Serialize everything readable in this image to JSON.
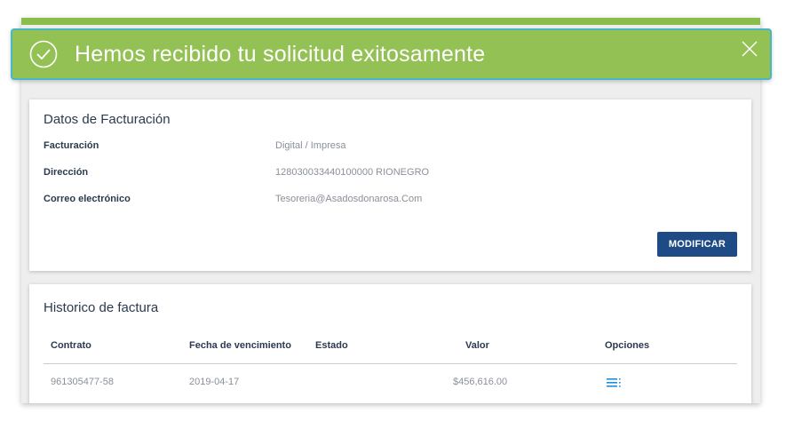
{
  "toast": {
    "message": "Hemos recibido tu solicitud exitosamente",
    "check_icon": "check-circle-icon",
    "close_icon": "close-icon"
  },
  "billing": {
    "title": "Datos de Facturación",
    "rows": [
      {
        "label": "Facturación",
        "value": "Digital / Impresa"
      },
      {
        "label": "Dirección",
        "value": "128030033440100000 RIONEGRO"
      },
      {
        "label": "Correo electrónico",
        "value": "Tesoreria@Asadosdonarosa.Com"
      }
    ],
    "modify_label": "MODIFICAR"
  },
  "history": {
    "title": "Historico de factura",
    "headers": {
      "contract": "Contrato",
      "due_date": "Fecha de vencimiento",
      "status": "Estado",
      "value": "Valor",
      "options": "Opciones"
    },
    "rows": [
      {
        "contract": "961305477-58",
        "due_date": "2019-04-17",
        "status": "",
        "value": "$456,616.00",
        "options_icon": "list-menu-icon"
      }
    ]
  },
  "colors": {
    "toast_bg": "#94c154",
    "toast_border": "#4ab7c4",
    "primary_button": "#1e4b85",
    "icon_accent": "#1e8fe0"
  }
}
